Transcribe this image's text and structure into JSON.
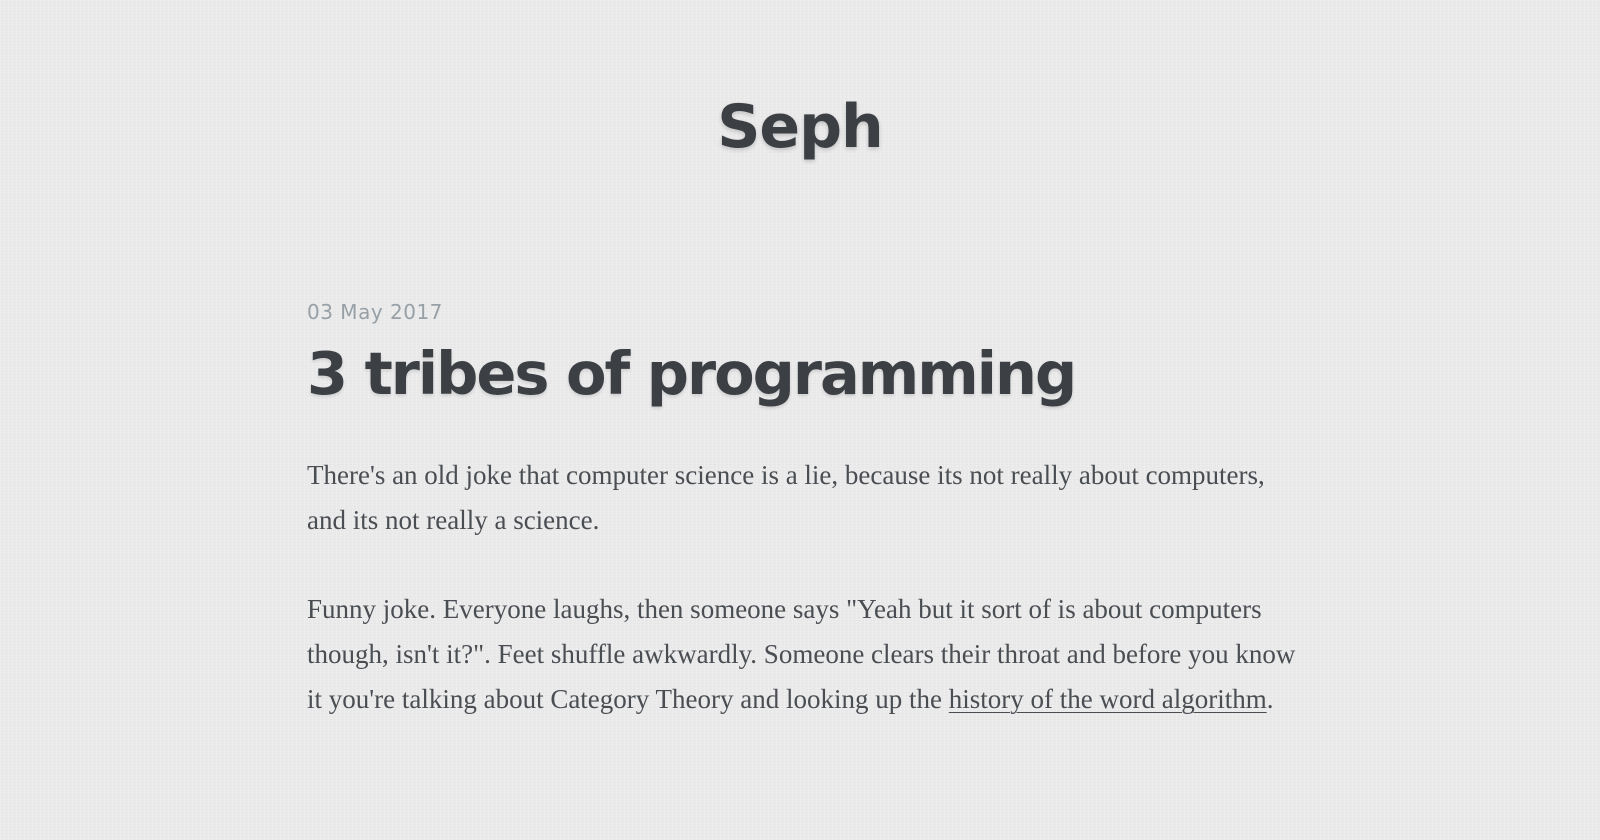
{
  "site": {
    "title": "Seph"
  },
  "post": {
    "date": "03 May 2017",
    "title": "3 tribes of programming",
    "paragraph1": "There's an old joke that computer science is a lie, because its not really about computers, and its not really a science.",
    "paragraph2_text": "Funny joke. Everyone laughs, then someone says \"Yeah but it sort of is about computers though, isn't it?\". Feet shuffle awkwardly. Someone clears their throat and before you know it you're talking about Category Theory and looking up the ",
    "paragraph2_link": "history of the word algorithm",
    "paragraph2_end": "."
  },
  "colors": {
    "background": "#eaeaea",
    "text": "#3c4045",
    "date": "#96a0a6"
  }
}
